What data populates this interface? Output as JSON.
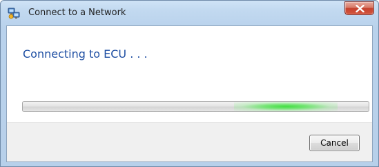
{
  "window": {
    "title": "Connect to a Network",
    "title_icon": "network-connect-icon",
    "close_icon": "close-x-icon"
  },
  "main": {
    "instruction": "Connecting to ECU . . ."
  },
  "progress": {
    "mode": "indeterminate",
    "glow_center_fraction": 0.76,
    "accent_color": "#3cdc3c"
  },
  "footer": {
    "cancel_label": "Cancel"
  },
  "colors": {
    "instruction_text": "#1f4fa3",
    "close_button": "#c5412d"
  }
}
